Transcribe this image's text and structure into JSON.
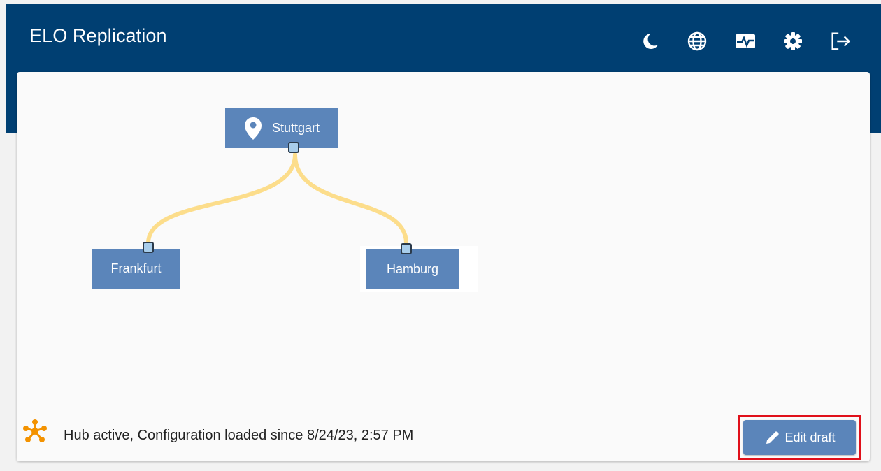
{
  "app": {
    "title": "ELO Replication"
  },
  "header_icons": [
    {
      "name": "dark-mode-icon"
    },
    {
      "name": "language-globe-icon"
    },
    {
      "name": "monitoring-pulse-icon"
    },
    {
      "name": "settings-gear-icon"
    },
    {
      "name": "logout-icon"
    }
  ],
  "topology": {
    "hub": {
      "label": "Stuttgart",
      "icon": "location-pin-icon"
    },
    "nodes": [
      {
        "label": "Frankfurt"
      },
      {
        "label": "Hamburg"
      }
    ],
    "connection_color": "#fcdd8b",
    "node_color": "#5b85ba"
  },
  "status": {
    "text": "Hub active, Configuration loaded since 8/24/23, 2:57 PM",
    "icon": "hub-status-icon",
    "icon_color": "#f39200"
  },
  "actions": {
    "edit_draft_label": "Edit draft"
  },
  "colors": {
    "header": "#003f72",
    "highlight": "#e0101a"
  }
}
